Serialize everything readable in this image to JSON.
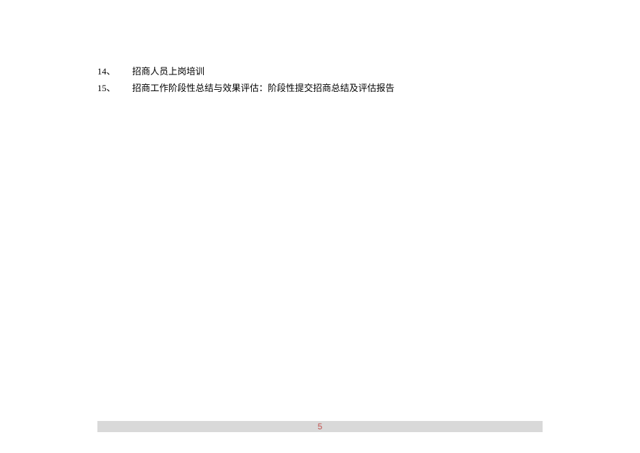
{
  "items": [
    {
      "number": "14、",
      "text": "招商人员上岗培训"
    },
    {
      "number": "15、",
      "text": "招商工作阶段性总结与效果评估：阶段性提交招商总结及评估报告"
    }
  ],
  "pageNumber": "5"
}
